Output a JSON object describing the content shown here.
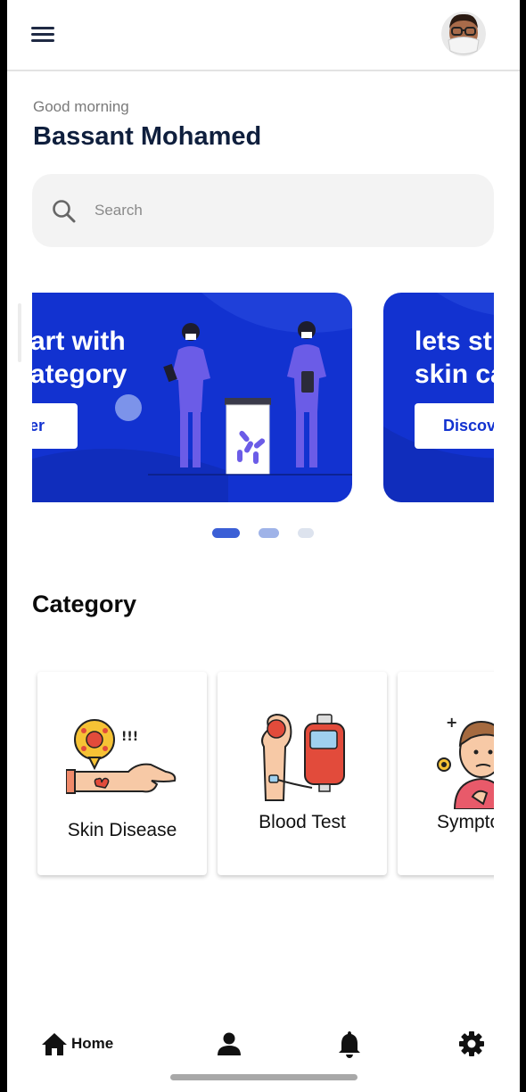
{
  "header": {
    "menu_icon": "hamburger-menu-icon",
    "avatar_icon": "user-avatar"
  },
  "greeting": "Good morning",
  "user_name": "Bassant Mohamed",
  "search": {
    "placeholder": "Search",
    "icon": "search-icon"
  },
  "carousel": {
    "slides": [
      {
        "title": "art with\nategory",
        "button": "er"
      },
      {
        "title": "lets st\nskin ca",
        "button": "Discov"
      }
    ],
    "active_index": 0,
    "dot_count": 3
  },
  "category": {
    "title": "Category",
    "items": [
      {
        "label": "Skin Disease",
        "icon": "skin-disease-icon"
      },
      {
        "label": "Blood Test",
        "icon": "blood-test-icon"
      },
      {
        "label": "Sympto",
        "icon": "symptoms-icon"
      }
    ]
  },
  "bottom_nav": {
    "home_label": "Home",
    "items": [
      "home-icon",
      "profile-icon",
      "notification-bell-icon",
      "settings-gear-icon"
    ]
  },
  "colors": {
    "accent": "#1232d0",
    "dark_text": "#0f1f3d",
    "dot_active": "#3b5fd6"
  }
}
